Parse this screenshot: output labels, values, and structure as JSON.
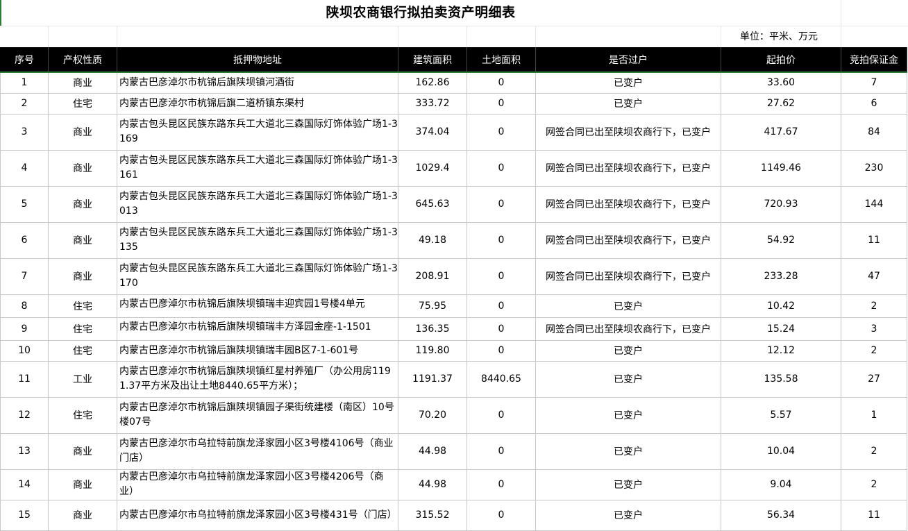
{
  "title": "陕坝农商银行拟拍卖资产明细表",
  "unit": "单位：平米、万元",
  "headers": [
    "序号",
    "产权性质",
    "抵押物地址",
    "建筑面积",
    "土地面积",
    "是否过户",
    "起拍价",
    "竞拍保证金"
  ],
  "rows": [
    {
      "no": "1",
      "type": "商业",
      "addr": "内蒙古巴彦淖尔市杭锦后旗陕坝镇河酒街",
      "area": "162.86",
      "land": "0",
      "transfer": "已变户",
      "price": "33.60",
      "deposit": "7"
    },
    {
      "no": "2",
      "type": "住宅",
      "addr": "内蒙古巴彦淖尔市杭锦后旗二道桥镇东渠村",
      "area": "333.72",
      "land": "0",
      "transfer": "已变户",
      "price": "27.62",
      "deposit": "6"
    },
    {
      "no": "3",
      "type": "商业",
      "addr": "内蒙古包头昆区民族东路东兵工大道北三森国际灯饰体验广场1-3169",
      "area": "374.04",
      "land": "0",
      "transfer": "网签合同已出至陕坝农商行下，已变户",
      "price": "417.67",
      "deposit": "84"
    },
    {
      "no": "4",
      "type": "商业",
      "addr": "内蒙古包头昆区民族东路东兵工大道北三森国际灯饰体验广场1-3161",
      "area": "1029.4",
      "land": "0",
      "transfer": "网签合同已出至陕坝农商行下，已变户",
      "price": "1149.46",
      "deposit": "230"
    },
    {
      "no": "5",
      "type": "商业",
      "addr": "内蒙古包头昆区民族东路东兵工大道北三森国际灯饰体验广场1-3013",
      "area": "645.63",
      "land": "0",
      "transfer": "网签合同已出至陕坝农商行下，已变户",
      "price": "720.93",
      "deposit": "144"
    },
    {
      "no": "6",
      "type": "商业",
      "addr": "内蒙古包头昆区民族东路东兵工大道北三森国际灯饰体验广场1-3135",
      "area": "49.18",
      "land": "0",
      "transfer": "网签合同已出至陕坝农商行下，已变户",
      "price": "54.92",
      "deposit": "11"
    },
    {
      "no": "7",
      "type": "商业",
      "addr": "内蒙古包头昆区民族东路东兵工大道北三森国际灯饰体验广场1-3170",
      "area": "208.91",
      "land": "0",
      "transfer": "网签合同已出至陕坝农商行下，已变户",
      "price": "233.28",
      "deposit": "47"
    },
    {
      "no": "8",
      "type": "住宅",
      "addr": "内蒙古巴彦淖尔市杭锦后旗陕坝镇瑞丰迎宾园1号楼4单元",
      "area": "75.95",
      "land": "0",
      "transfer": "已变户",
      "price": "10.42",
      "deposit": "2"
    },
    {
      "no": "9",
      "type": "住宅",
      "addr": "内蒙古巴彦淖尔市杭锦后旗陕坝镇瑞丰方泽园金座-1-1501",
      "area": "136.35",
      "land": "0",
      "transfer": "网签合同已出至陕坝农商行下，已变户",
      "price": "15.24",
      "deposit": "3"
    },
    {
      "no": "10",
      "type": "住宅",
      "addr": "内蒙古巴彦淖尔市杭锦后旗陕坝镇瑞丰园B区7-1-601号",
      "area": "119.80",
      "land": "0",
      "transfer": "已变户",
      "price": "12.12",
      "deposit": "2"
    },
    {
      "no": "11",
      "type": "工业",
      "addr": "内蒙古巴彦淖尔市杭锦后旗陕坝镇红星村养殖厂（办公用房1191.37平方米及出让土地8440.65平方米）；",
      "area": "1191.37",
      "land": "8440.65",
      "transfer": "已变户",
      "price": "135.58",
      "deposit": "27"
    },
    {
      "no": "12",
      "type": "住宅",
      "addr": "内蒙古巴彦淖尔市杭锦后旗陕坝镇园子渠街统建楼（南区）10号楼07号",
      "area": "70.20",
      "land": "0",
      "transfer": "已变户",
      "price": "5.57",
      "deposit": "1"
    },
    {
      "no": "13",
      "type": "商业",
      "addr": "内蒙古巴彦淖尔市乌拉特前旗龙泽家园小区3号楼4106号（商业门店）",
      "area": "44.98",
      "land": "0",
      "transfer": "已变户",
      "price": "10.04",
      "deposit": "2"
    },
    {
      "no": "14",
      "type": "商业",
      "addr": "内蒙古巴彦淖尔市乌拉特前旗龙泽家园小区3号楼4206号（商业）",
      "area": "44.98",
      "land": "0",
      "transfer": "已变户",
      "price": "9.04",
      "deposit": "2"
    },
    {
      "no": "15",
      "type": "商业",
      "addr": "内蒙古巴彦淖尔市乌拉特前旗龙泽家园小区3号楼431号（门店）",
      "area": "315.52",
      "land": "0",
      "transfer": "已变户",
      "price": "56.34",
      "deposit": "11"
    }
  ]
}
